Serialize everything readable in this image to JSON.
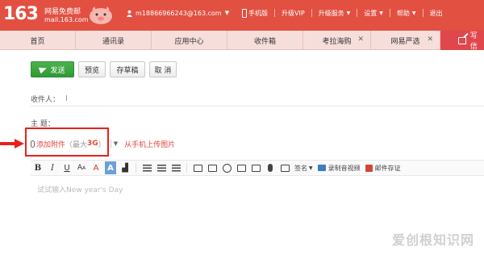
{
  "header": {
    "logo_number": "163",
    "logo_free": "网易免费邮",
    "logo_url": "mail.163.com",
    "user_email": "m18866966243@163.com",
    "links": [
      "手机版",
      "升级VIP",
      "升级服务",
      "设置",
      "帮助",
      "退出"
    ]
  },
  "tabs": [
    {
      "label": "首页",
      "closable": false
    },
    {
      "label": "通讯录",
      "closable": false
    },
    {
      "label": "应用中心",
      "closable": false
    },
    {
      "label": "收件箱",
      "closable": false
    },
    {
      "label": "考拉海购",
      "closable": true
    },
    {
      "label": "网易严选",
      "closable": true
    },
    {
      "label": "写信",
      "active": true
    }
  ],
  "toolbar": {
    "send": "发送",
    "preview": "预览",
    "save_draft": "存草稿",
    "cancel": "取 消"
  },
  "fields": {
    "recipient_label": "收件人：",
    "subject_label": "主    题："
  },
  "attachment": {
    "add_prefix": "添加附件",
    "limit_open": "（最大",
    "limit_value": "3G",
    "limit_close": "）",
    "upload_from_phone": "从手机上传图片"
  },
  "editor": {
    "signature": "签名",
    "record_video": "录制音视频",
    "postcard": "邮件存证",
    "placeholder": "试试输入New year's Day"
  },
  "watermark": "爱创根知识网",
  "colors": {
    "brand": "#e25042",
    "highlight": "#e8211b",
    "send_button": "#3aa53e"
  }
}
